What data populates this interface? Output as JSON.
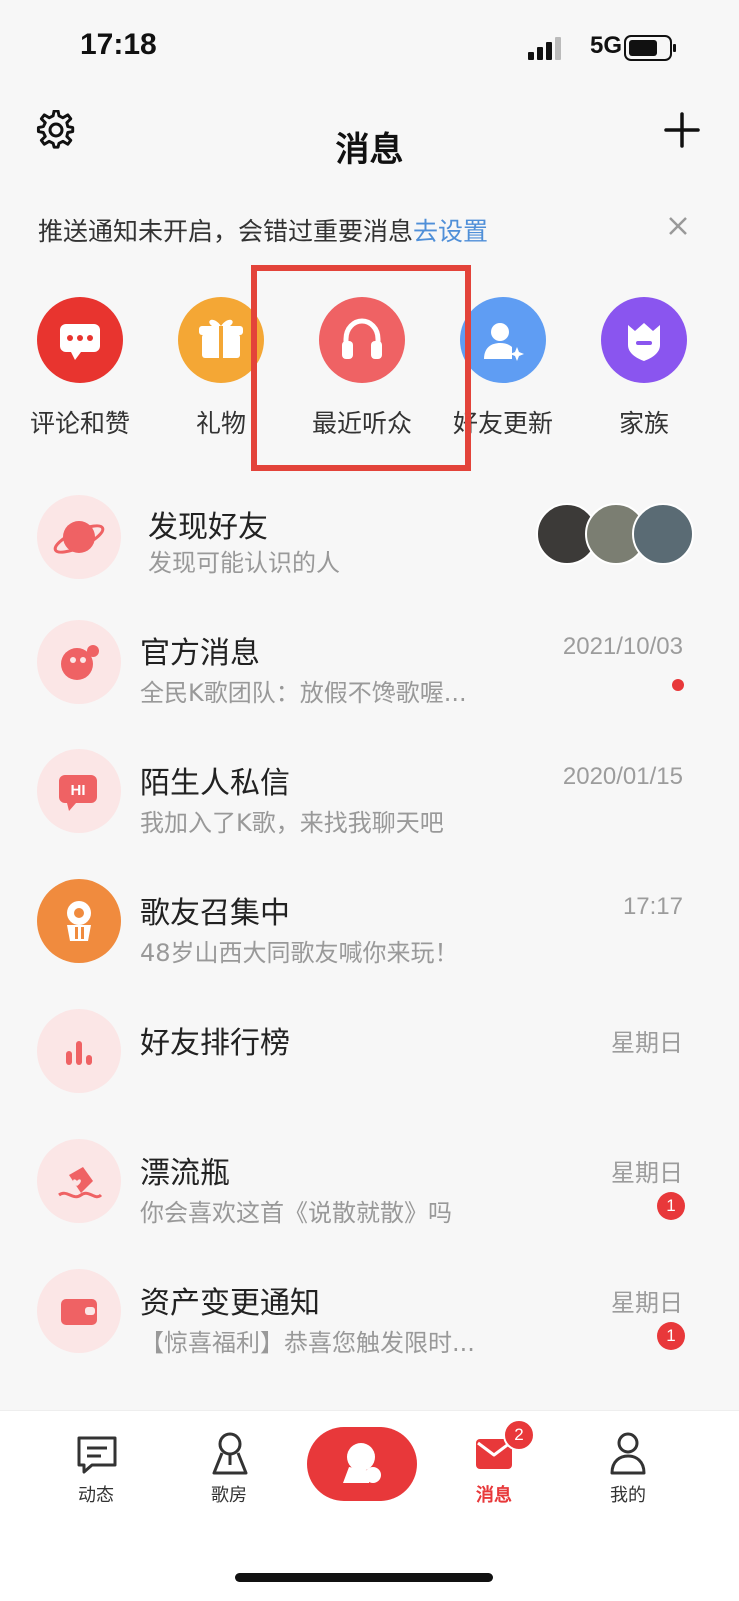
{
  "status_bar": {
    "time": "17:18",
    "network": "5G"
  },
  "header": {
    "title": "消息"
  },
  "banner": {
    "text": "推送通知未开启，会错过重要消息",
    "link": "去设置"
  },
  "shortcuts": [
    {
      "label": "评论和赞",
      "color": "#e8342f",
      "icon": "comment-icon"
    },
    {
      "label": "礼物",
      "color": "#f4a735",
      "icon": "gift-icon"
    },
    {
      "label": "最近听众",
      "color": "#ef6264",
      "icon": "headphones-icon"
    },
    {
      "label": "好友更新",
      "color": "#5f9df3",
      "icon": "user-star-icon"
    },
    {
      "label": "家族",
      "color": "#8a55ef",
      "icon": "shield-crown-icon"
    }
  ],
  "messages": [
    {
      "title": "发现好友",
      "subtitle": "发现可能认识的人",
      "icon": "planet-icon"
    },
    {
      "title": "官方消息",
      "subtitle": "全民K歌团队：放假不馋歌喔...",
      "time": "2021/10/03",
      "icon": "official-icon"
    },
    {
      "title": "陌生人私信",
      "subtitle": "我加入了K歌，来找我聊天吧",
      "time": "2020/01/15",
      "icon": "hi-icon"
    },
    {
      "title": "歌友召集中",
      "subtitle": "48岁山西大同歌友喊你来玩！",
      "time": "17:17",
      "icon": "mic-group-icon"
    },
    {
      "title": "好友排行榜",
      "subtitle": "",
      "time": "星期日",
      "icon": "bar-chart-icon"
    },
    {
      "title": "漂流瓶",
      "subtitle": "你会喜欢这首《说散就散》吗",
      "time": "星期日",
      "badge": "1",
      "icon": "bottle-icon"
    },
    {
      "title": "资产变更通知",
      "subtitle": "【惊喜福利】恭喜您触发限时...",
      "time": "星期日",
      "badge": "1",
      "icon": "wallet-icon"
    }
  ],
  "bottom_nav": [
    {
      "label": "动态"
    },
    {
      "label": "歌房"
    },
    {
      "label": ""
    },
    {
      "label": "消息",
      "badge": "2"
    },
    {
      "label": "我的"
    }
  ],
  "colors": {
    "accent": "#e8383a",
    "link": "#4f8fd8"
  }
}
